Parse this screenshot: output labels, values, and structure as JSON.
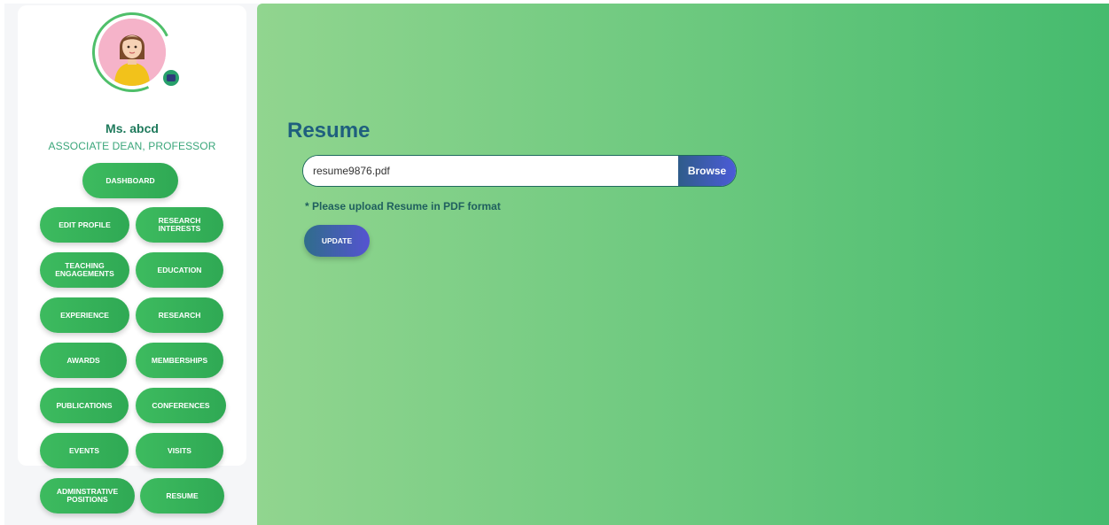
{
  "profile": {
    "name": "Ms. abcd",
    "role": "ASSOCIATE DEAN, PROFESSOR"
  },
  "nav": {
    "dashboard": "DASHBOARD",
    "edit_profile": "EDIT PROFILE",
    "research_interests": "RESEARCH INTERESTS",
    "teaching_engagements": "TEACHING ENGAGEMENTS",
    "education": "EDUCATION",
    "experience": "EXPERIENCE",
    "research": "RESEARCH",
    "awards": "AWARDS",
    "memberships": "MEMBERSHIPS",
    "publications": "PUBLICATIONS",
    "conferences": "CONFERENCES",
    "events": "EVENTS",
    "visits": "VISITS",
    "administrative_positions": "ADMINSTRATIVE POSITIONS",
    "resume": "RESUME"
  },
  "main": {
    "title": "Resume",
    "file_value": "resume9876.pdf",
    "browse_label": "Browse",
    "hint": "* Please upload Resume in PDF format",
    "update_label": "UPDATE"
  },
  "colors": {
    "accent_green": "#3dbb5f",
    "title_blue": "#1f5f7e",
    "button_gradient_end": "#5553d1"
  }
}
